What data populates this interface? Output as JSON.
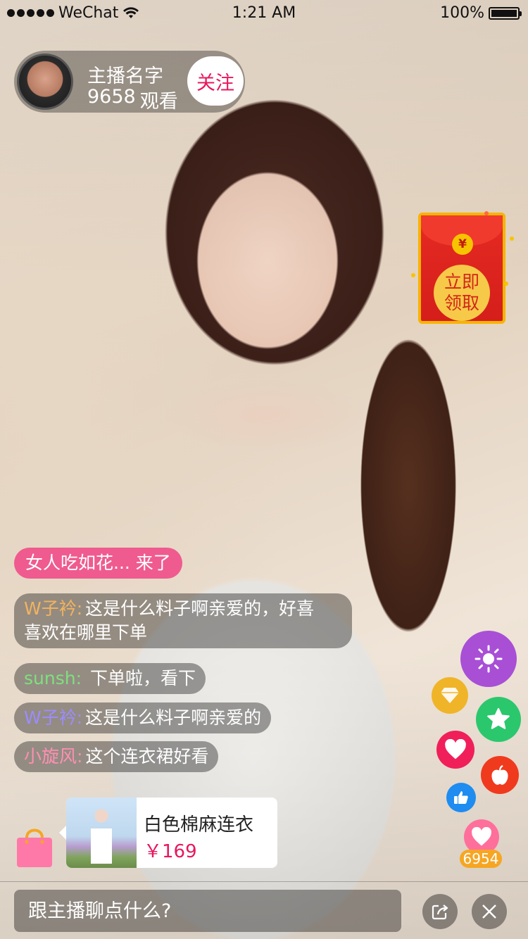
{
  "status_bar": {
    "carrier": "WeChat",
    "time": "1:21 AM",
    "battery": "100%",
    "battery_level": 1.0
  },
  "host": {
    "name": "主播名字",
    "viewer_count": "9658",
    "viewer_label": "观看",
    "follow_label": "关注"
  },
  "red_packet": {
    "coin_symbol": "¥",
    "claim_line1": "立即",
    "claim_line2": "领取"
  },
  "entry_notice": "女人吃如花... 来了",
  "chat": [
    {
      "user": "W子衿:",
      "text": "这是什么料子啊亲爱的，好喜",
      "text2": "喜欢在哪里下单",
      "user_color": "#f2b35f"
    },
    {
      "user": "sunsh:",
      "text": "下单啦，看下",
      "user_color": "#7ee07e"
    },
    {
      "user": "W子衿:",
      "text": "这是什么料子啊亲爱的",
      "user_color": "#9b8cff"
    },
    {
      "user": "小旋风:",
      "text": "这个连衣裙好看",
      "user_color": "#ff8fb3"
    }
  ],
  "product": {
    "title": "白色棉麻连衣",
    "price": "￥169"
  },
  "likes": {
    "count": "6954"
  },
  "input": {
    "placeholder": "跟主播聊点什么?"
  },
  "colors": {
    "accent_pink": "#e8175d",
    "follow_text": "#e8175d",
    "price": "#e8175d",
    "like_badge": "#f6a623"
  },
  "icons": {
    "share": "share-icon",
    "close": "close-icon",
    "shop": "shopping-bag-icon",
    "sun": "sun-icon",
    "diamond": "diamond-icon",
    "star": "star-icon",
    "heart": "heart-icon",
    "apple": "apple-icon",
    "thumbs_up": "thumbs-up-icon",
    "like_heart": "like-heart-icon"
  }
}
